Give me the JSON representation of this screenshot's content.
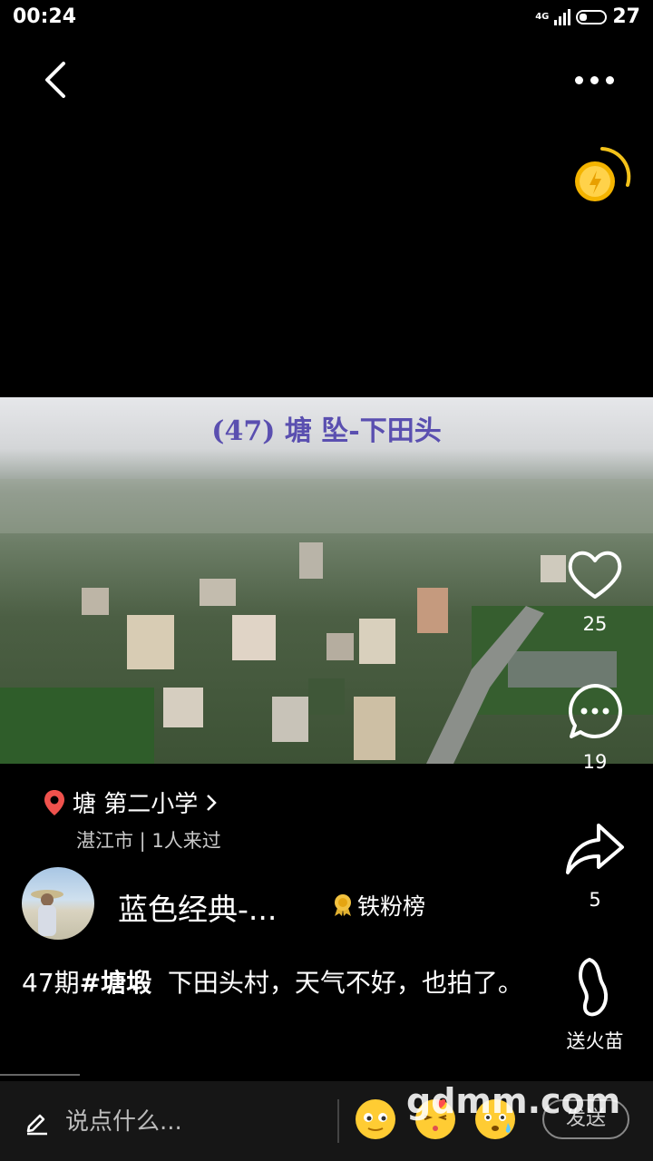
{
  "status": {
    "time": "00:24",
    "network": "4G",
    "battery": "27"
  },
  "video": {
    "overlay_title": "(47) 塘 坠-下田头"
  },
  "actions": {
    "likes": "25",
    "comments": "19",
    "shares": "5",
    "gift_label": "送火苗"
  },
  "location": {
    "name": "塘 第二小学",
    "detail": "湛江市 | 1人来过"
  },
  "author": {
    "name": "蓝色经典-...",
    "badge": "铁粉榜"
  },
  "post": {
    "prefix": "47期",
    "tag": "#塘塅",
    "text": "下田头村，天气不好，也拍了。"
  },
  "composer": {
    "placeholder": "说点什么...",
    "send_label": "发送"
  },
  "watermark": "gdmm.com"
}
